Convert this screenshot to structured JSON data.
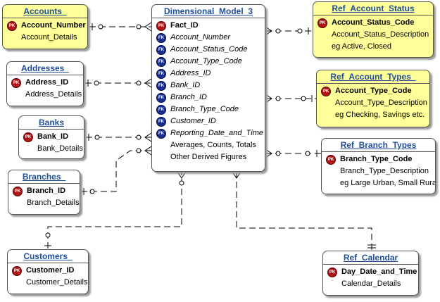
{
  "entities": {
    "accounts": {
      "title": "Accounts_",
      "pk": "Account_Number",
      "rows": [
        "Account_Details"
      ]
    },
    "addresses": {
      "title": "Addresses_",
      "pk": "Address_ID",
      "rows": [
        "Address_Details"
      ]
    },
    "banks": {
      "title": "Banks",
      "pk": "Bank_ID",
      "rows": [
        "Bank_Details"
      ]
    },
    "branches": {
      "title": "Branches_",
      "pk": "Branch_ID",
      "rows": [
        "Branch_Details"
      ]
    },
    "customers": {
      "title": "Customers_",
      "pk": "Customer_ID",
      "rows": [
        "Customer_Details"
      ]
    },
    "dimensional_model": {
      "title": "Dimensional_Model_3",
      "pk": "Fact_ID",
      "fks": [
        "Account_Number",
        "Account_Status_Code",
        "Account_Type_Code",
        "Address_ID",
        "Bank_ID",
        "Branch_ID",
        "Branch_Type_Code",
        "Customer_ID",
        "Reporting_Date_and_Time"
      ],
      "rows": [
        "Averages, Counts, Totals",
        "Other Derived Figures"
      ]
    },
    "ref_account_status": {
      "title": "Ref_Account_Status",
      "pk": "Account_Status_Code",
      "rows": [
        "Account_Status_Description",
        "eg Active, Closed"
      ]
    },
    "ref_account_types": {
      "title": "Ref_Account_Types_",
      "pk": "Account_Type_Code",
      "rows": [
        "Account_Type_Description",
        "eg Checking, Savings etc."
      ]
    },
    "ref_branch_types": {
      "title": "Ref_Branch_Types",
      "pk": "Branch_Type_Code",
      "rows": [
        "Branch_Type_Description",
        "eg Large Urban, Small Rural"
      ]
    },
    "ref_calendar": {
      "title": "Ref_Calendar",
      "pk": "Day_Date_and_Time",
      "rows": [
        "Calendar_Details"
      ]
    }
  },
  "badges": {
    "pk": "PK",
    "fk": "FK"
  },
  "colors": {
    "title_text": "#1f4e9a",
    "yellow_fill": "#ffff99",
    "pk_badge": "#b01515",
    "fk_badge": "#1a2f8c"
  }
}
